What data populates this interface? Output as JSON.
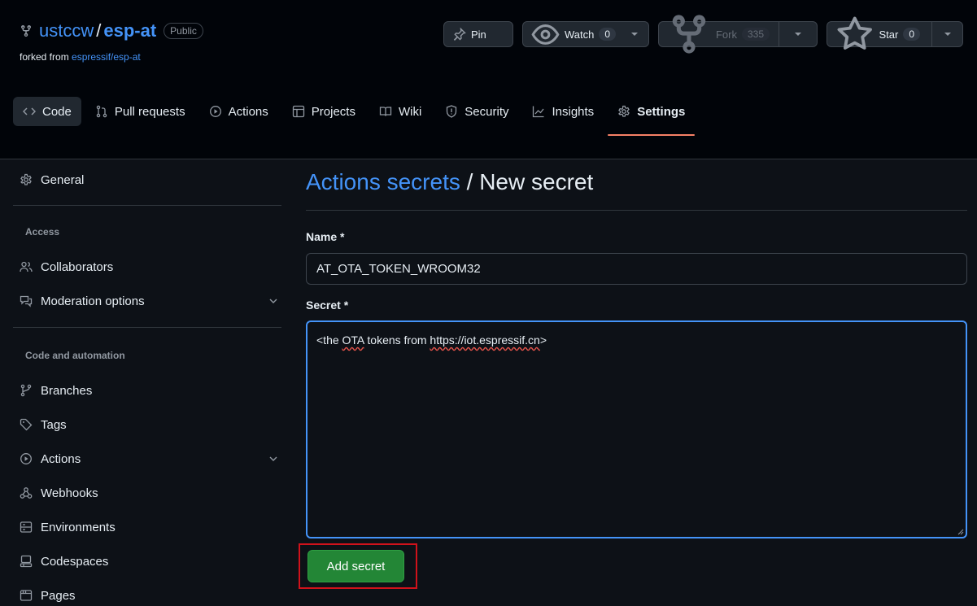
{
  "repo": {
    "owner": "ustccw",
    "separator": "/",
    "name": "esp-at",
    "visibility": "Public",
    "forked_from_prefix": "forked from",
    "forked_from_link": "espressif/esp-at"
  },
  "actions": {
    "pin_label": "Pin",
    "watch_label": "Watch",
    "watch_count": "0",
    "fork_label": "Fork",
    "fork_count": "335",
    "star_label": "Star",
    "star_count": "0"
  },
  "tabs": [
    {
      "label": "Code",
      "icon": "code-icon"
    },
    {
      "label": "Pull requests",
      "icon": "pull-request-icon"
    },
    {
      "label": "Actions",
      "icon": "play-icon"
    },
    {
      "label": "Projects",
      "icon": "table-icon"
    },
    {
      "label": "Wiki",
      "icon": "book-icon"
    },
    {
      "label": "Security",
      "icon": "shield-icon"
    },
    {
      "label": "Insights",
      "icon": "graph-icon"
    },
    {
      "label": "Settings",
      "icon": "gear-icon"
    }
  ],
  "sidebar": {
    "general": "General",
    "access_heading": "Access",
    "collaborators": "Collaborators",
    "moderation": "Moderation options",
    "code_heading": "Code and automation",
    "branches": "Branches",
    "tags": "Tags",
    "actions": "Actions",
    "webhooks": "Webhooks",
    "environments": "Environments",
    "codespaces": "Codespaces",
    "pages": "Pages"
  },
  "form": {
    "breadcrumb_link": "Actions secrets",
    "breadcrumb_sep": " / ",
    "breadcrumb_current": "New secret",
    "name_label": "Name *",
    "name_value": "AT_OTA_TOKEN_WROOM32",
    "secret_label": "Secret *",
    "secret_part1": "<the ",
    "secret_part2": "OTA",
    "secret_part3": " tokens from ",
    "secret_part4": "https://iot.espressif.cn",
    "secret_part5": ">",
    "submit_label": "Add secret"
  },
  "colors": {
    "accent": "#4493f8",
    "submit": "#238636",
    "tab_underline": "#f78166",
    "highlight_box": "#d0121b"
  }
}
